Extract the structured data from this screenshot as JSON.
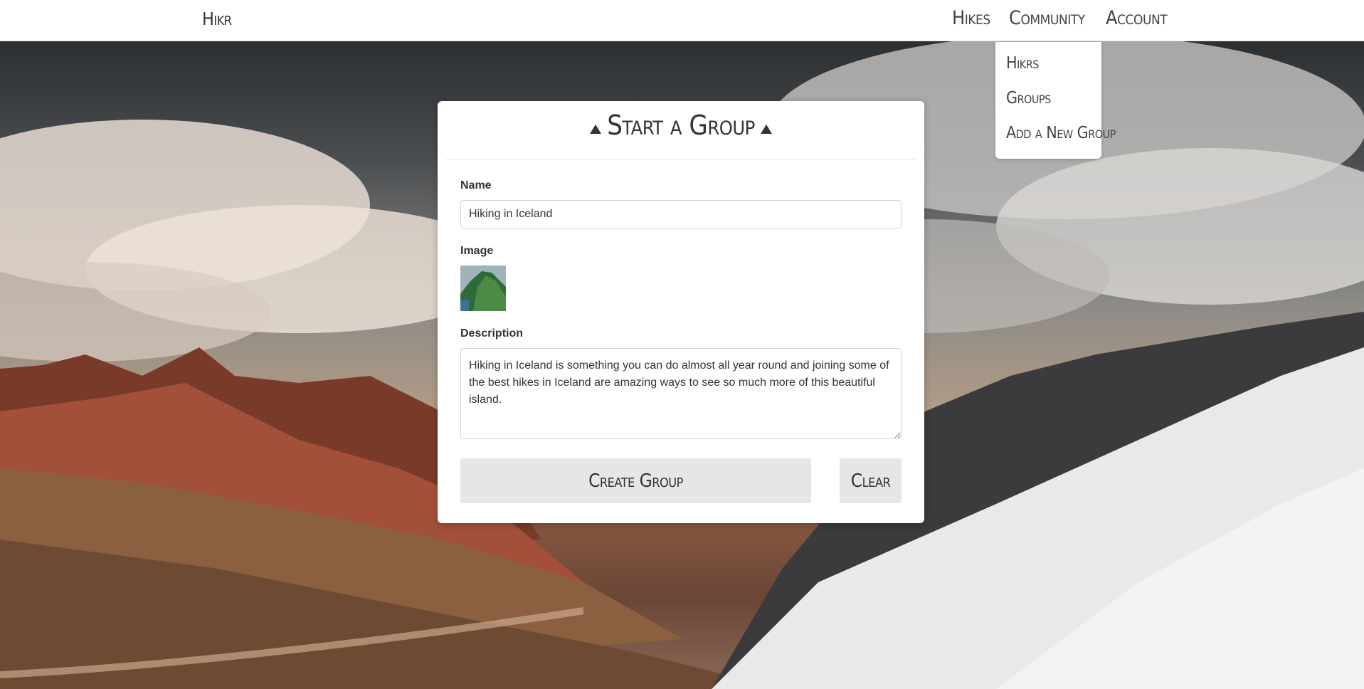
{
  "navbar": {
    "brand": "Hikr",
    "links": [
      "Hikes",
      "Community",
      "Account"
    ]
  },
  "dropdown": {
    "items": [
      "Hikrs",
      "Groups",
      "Add a New Group"
    ]
  },
  "form": {
    "title": "Start a Group",
    "name_label": "Name",
    "name_value": "Hiking in Iceland",
    "image_label": "Image",
    "description_label": "Description",
    "description_value": "Hiking in Iceland is something you can do almost all year round and joining some of the best hikes in Iceland are amazing ways to see so much more of this beautiful island.",
    "create_label": "Create Group",
    "clear_label": "Clear"
  },
  "icons": {
    "title_icon": "mountain-triangle-icon",
    "thumb": "iceland-cliff-thumbnail"
  }
}
